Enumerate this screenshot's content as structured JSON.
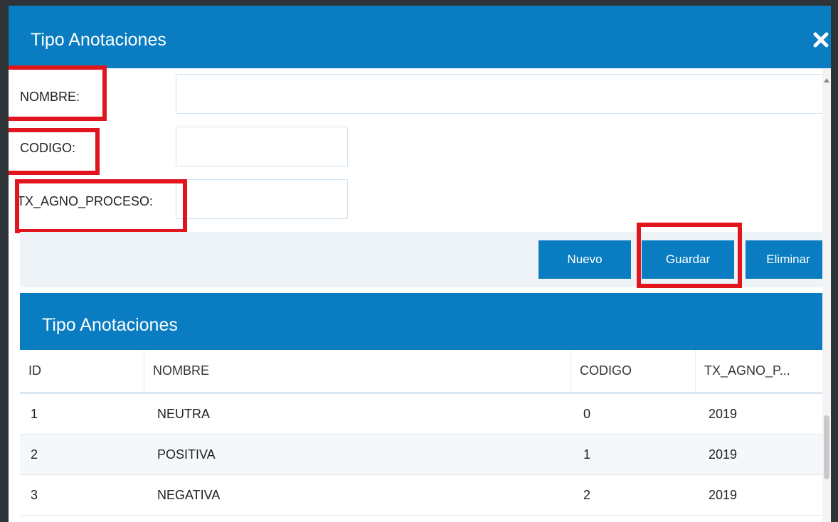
{
  "modal": {
    "title": "Tipo Anotaciones",
    "close_icon": "close-icon"
  },
  "form": {
    "nombre_label": "NOMBRE:",
    "nombre_value": "",
    "codigo_label": "CODIGO:",
    "codigo_value": "",
    "agno_label": "TX_AGNO_PROCESO:",
    "agno_value": ""
  },
  "buttons": {
    "nuevo": "Nuevo",
    "guardar": "Guardar",
    "eliminar": "Eliminar"
  },
  "panel": {
    "title": "Tipo Anotaciones"
  },
  "table": {
    "columns": [
      "ID",
      "NOMBRE",
      "CODIGO",
      "TX_AGNO_P..."
    ],
    "rows": [
      [
        "1",
        "NEUTRA",
        "0",
        "2019"
      ],
      [
        "2",
        "POSITIVA",
        "1",
        "2019"
      ],
      [
        "3",
        "NEGATIVA",
        "2",
        "2019"
      ]
    ]
  },
  "colors": {
    "accent": "#0a7cc1",
    "highlight": "#e0151d"
  }
}
